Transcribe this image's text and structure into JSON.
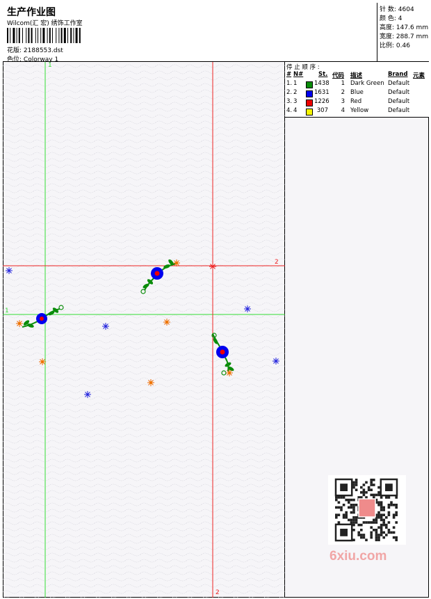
{
  "header": {
    "title": "生产作业图",
    "subtitle": "Wilcom(汇 宏) 绣饰工作室",
    "design_label": "花版:",
    "design_value": "2188553.dst",
    "colorway_label": "色位:",
    "colorway_value": "Colorway 1"
  },
  "info": {
    "stitches_label": "针 数:",
    "stitches_value": "4604",
    "colors_label": "颜 色:",
    "colors_value": "4",
    "height_label": "高度:",
    "height_value": "147.6 mm",
    "width_label": "宽度:",
    "width_value": "288.7 mm",
    "scale_label": "比例:",
    "scale_value": "0.46"
  },
  "stop_sequence": {
    "title": "停 止 顺 序 :",
    "columns": [
      "#",
      "N#",
      "St.",
      "代码",
      "描述",
      "Brand",
      "元素"
    ],
    "rows": [
      {
        "idx": "1.",
        "n": "1",
        "st": "1438",
        "code": "1",
        "desc": "Dark Green",
        "brand": "Default",
        "color": "#0a8c0a"
      },
      {
        "idx": "2.",
        "n": "2",
        "st": "1631",
        "code": "2",
        "desc": "Blue",
        "brand": "Default",
        "color": "#0000ee"
      },
      {
        "idx": "3.",
        "n": "3",
        "st": "1226",
        "code": "3",
        "desc": "Red",
        "brand": "Default",
        "color": "#ee0000"
      },
      {
        "idx": "4.",
        "n": "4",
        "st": "307",
        "code": "4",
        "desc": "Yellow",
        "brand": "Default",
        "color": "#f5f500"
      }
    ]
  },
  "guides": {
    "green_label_top": "1",
    "green_label_left": "1",
    "red_label_right": "2",
    "red_label_bottom": "2"
  },
  "colors": {
    "green_guide": "#33dd33",
    "red_guide": "#ee2222"
  },
  "watermark": "6xiu.com"
}
